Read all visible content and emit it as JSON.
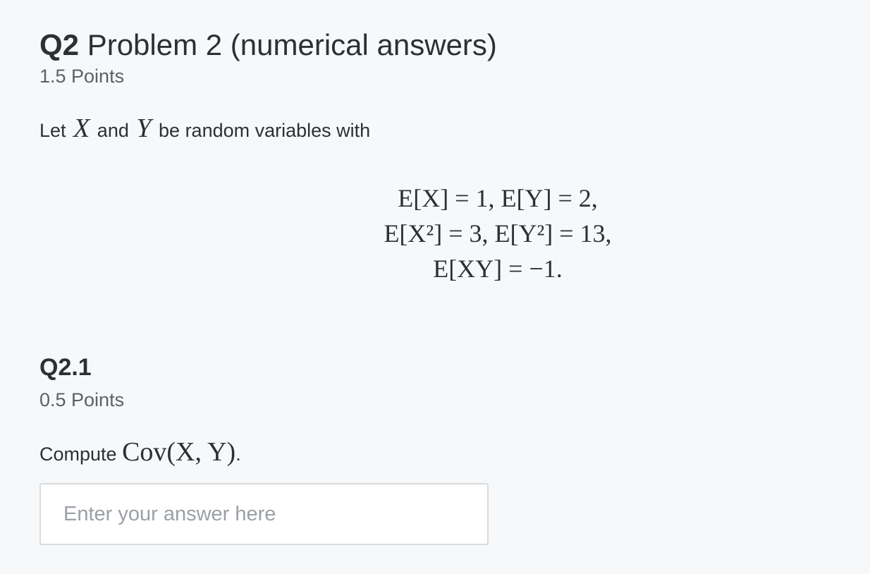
{
  "question": {
    "number": "Q2",
    "title": "Problem 2 (numerical answers)",
    "points": "1.5 Points",
    "prompt": {
      "prefix": "Let",
      "var_x": "X",
      "middle": "and",
      "var_y": "Y",
      "suffix": "be random variables with"
    },
    "equations": [
      "E[X] = 1,    E[Y] = 2,",
      "E[X²] = 3,    E[Y²] = 13,",
      "E[XY] = −1."
    ]
  },
  "subquestion": {
    "number": "Q2.1",
    "points": "0.5 Points",
    "prompt_prefix": "Compute",
    "prompt_math": "Cov(X, Y)",
    "prompt_suffix": ".",
    "answer_placeholder": "Enter your answer here",
    "answer_value": ""
  }
}
